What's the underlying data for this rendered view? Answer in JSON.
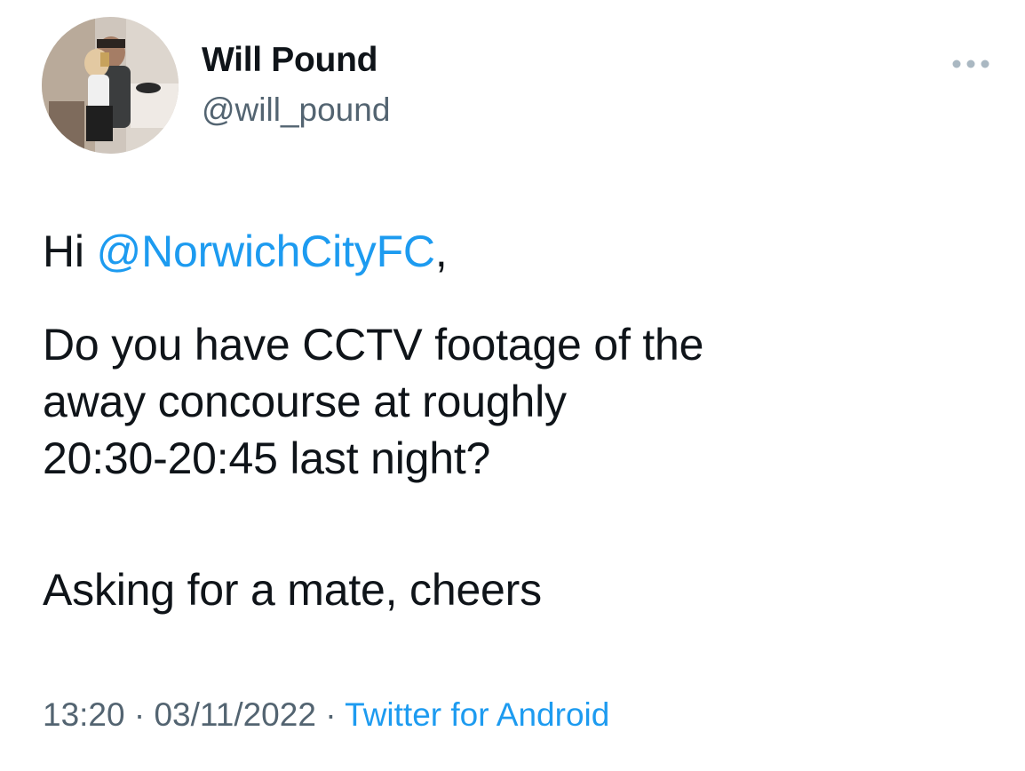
{
  "author": {
    "display_name": "Will Pound",
    "handle": "@will_pound",
    "avatar_icon": "profile-photo"
  },
  "tweet": {
    "greeting": "Hi ",
    "mention": "@NorwichCityFC",
    "greeting_end": ",",
    "line1": "Do you have CCTV footage of the",
    "line2": "away concourse at roughly",
    "line3": "20:30-20:45 last night?",
    "closing": "Asking for a mate, cheers"
  },
  "meta": {
    "time": "13:20",
    "separator1": " · ",
    "date": "03/11/2022",
    "separator2": " · ",
    "source": "Twitter for Android"
  },
  "colors": {
    "link": "#1d9bf0",
    "secondary": "#536471",
    "text": "#0f1419"
  },
  "icons": {
    "more": "more-horizontal-icon"
  }
}
